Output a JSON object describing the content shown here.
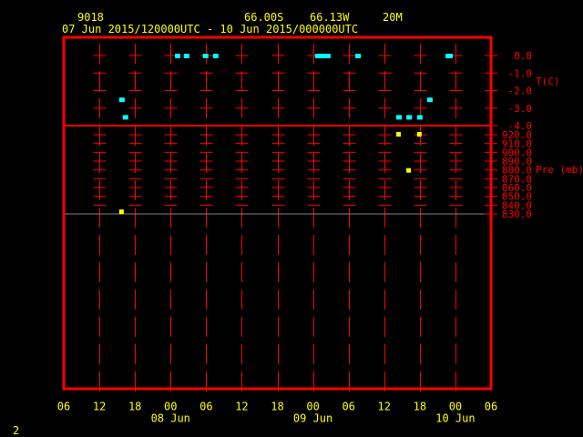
{
  "header": {
    "station": "9018",
    "latitude": "66.00S",
    "longitude": "66.13W",
    "height": "20M",
    "time_range": "07 Jun 2015/120000UTC - 10 Jun 2015/000000UTC"
  },
  "page_number": "2",
  "colors": {
    "frame": "#ff0000",
    "text": "#ffff00",
    "temperature": "#00ffff",
    "pressure": "#ffff00"
  },
  "chart_data": [
    {
      "type": "scatter",
      "title": "T(C)",
      "ylabel": "T(C)",
      "ylim": [
        -4.0,
        0.0
      ],
      "yticks": [
        "0.0",
        "-1.0",
        "-2.0",
        "-3.0",
        "-4.0"
      ],
      "x_unit": "hours since 07 Jun 2015 06UTC",
      "xlim": [
        0,
        72
      ],
      "x": [
        9.8,
        10.4,
        19.2,
        20.7,
        23.9,
        25.6,
        42.8,
        43.7,
        44.5,
        49.6,
        56.5,
        58.2,
        60.0,
        61.7,
        64.8,
        65.1
      ],
      "y": [
        -2.5,
        -3.5,
        0.0,
        0.0,
        0.0,
        0.0,
        0.0,
        0.0,
        0.0,
        0.0,
        -3.5,
        -3.5,
        -3.5,
        -2.5,
        0.0,
        0.0
      ]
    },
    {
      "type": "scatter",
      "title": "Pre (mb)",
      "ylabel": "Pre (mb)",
      "ylim": [
        830.0,
        920.0
      ],
      "yticks": [
        "920.0",
        "910.0",
        "900.0",
        "890.0",
        "880.0",
        "870.0",
        "860.0",
        "850.0",
        "840.0",
        "830.0"
      ],
      "x_unit": "hours since 07 Jun 2015 06UTC",
      "xlim": [
        0,
        72
      ],
      "x": [
        9.8,
        56.5,
        58.2,
        60.0
      ],
      "y": [
        833,
        921,
        880,
        921
      ]
    }
  ],
  "xaxis": {
    "ticks": [
      "06",
      "12",
      "18",
      "00",
      "06",
      "12",
      "18",
      "00",
      "06",
      "12",
      "18",
      "00",
      "06"
    ],
    "dates": [
      {
        "label": "08 Jun",
        "at": 18
      },
      {
        "label": "09 Jun",
        "at": 42
      },
      {
        "label": "10 Jun",
        "at": 66
      }
    ]
  }
}
